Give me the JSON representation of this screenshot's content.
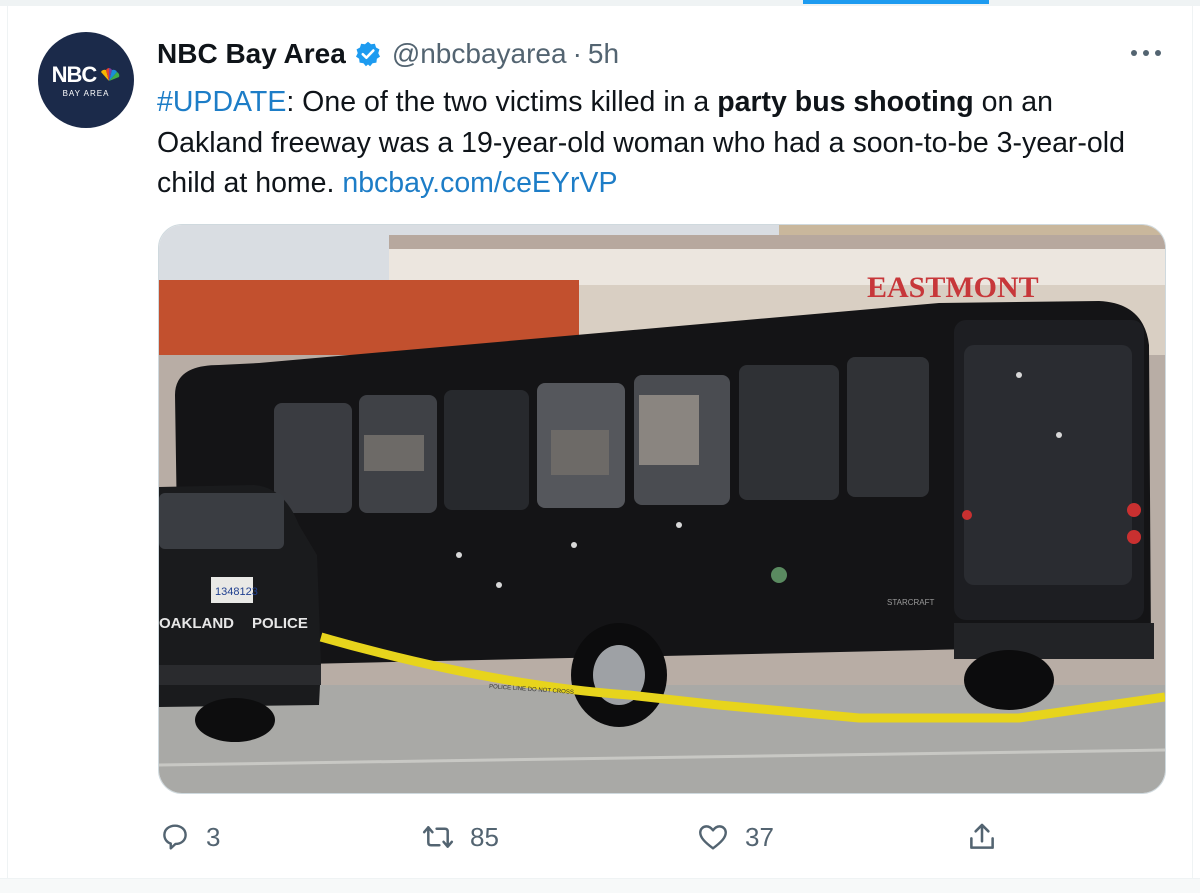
{
  "account": {
    "display_name": "NBC Bay Area",
    "handle": "@nbcbayarea",
    "separator": "·",
    "time": "5h",
    "avatar_logo": "NBC",
    "avatar_sub": "BAY AREA",
    "verified_icon": "verified-badge-icon"
  },
  "tweet": {
    "hashtag": "#UPDATE",
    "text_1": ": One of the two victims killed in a ",
    "bold": "party bus shooting",
    "text_2": " on an Oakland freeway was a 19-year-old woman who had a soon-to-be 3-year-old child at home. ",
    "link": "nbcbay.com/ceEYrVP"
  },
  "media": {
    "sign_text": "EASTMONT",
    "car_text": "OAKLAND",
    "car_text_2": "POLICE",
    "plate": "1348123",
    "tape_text": "POLICE LINE DO NOT CROSS",
    "bus_brand": "STARCRAFT"
  },
  "actions": {
    "reply_count": "3",
    "retweet_count": "85",
    "like_count": "37"
  },
  "colors": {
    "link": "#1d7dc7",
    "muted": "#536471",
    "accent": "#1d9bf0"
  }
}
